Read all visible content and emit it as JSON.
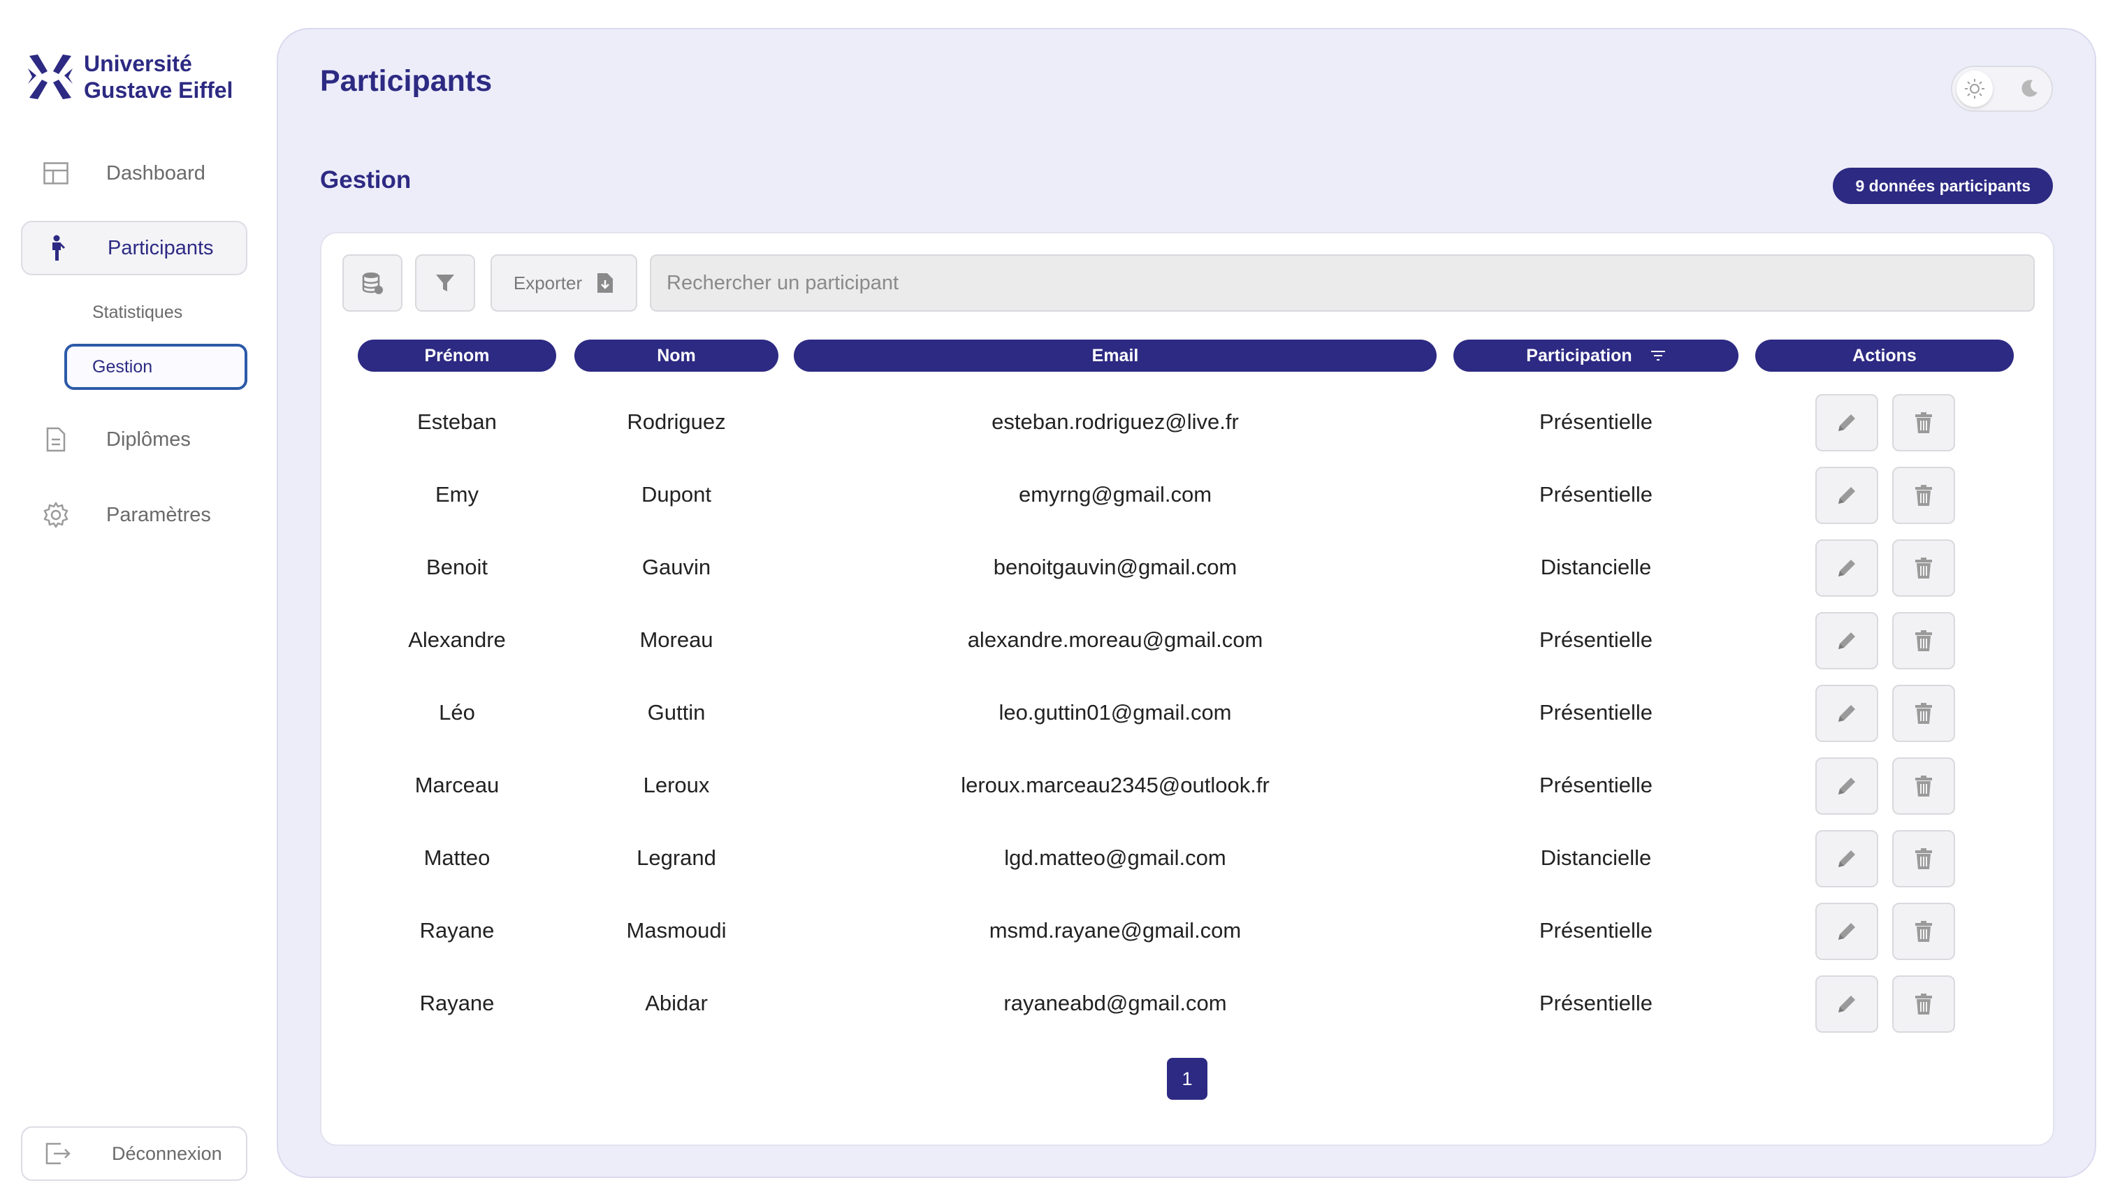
{
  "brand": {
    "line1": "Université",
    "line2": "Gustave Eiffel",
    "color": "#2d2a83"
  },
  "sidebar": {
    "items": [
      {
        "label": "Dashboard",
        "icon": "layout-icon"
      },
      {
        "label": "Participants",
        "icon": "person-icon",
        "active": true
      },
      {
        "label": "Diplômes",
        "icon": "document-icon"
      },
      {
        "label": "Paramètres",
        "icon": "gear-icon"
      }
    ],
    "subitems": [
      {
        "label": "Statistiques"
      },
      {
        "label": "Gestion",
        "active": true
      }
    ],
    "logout": "Déconnexion"
  },
  "header": {
    "title": "Participants"
  },
  "theme": {
    "light_icon": "sun-icon",
    "dark_icon": "moon-icon"
  },
  "section": {
    "title": "Gestion",
    "badge": "9 données participants"
  },
  "toolbar": {
    "db_icon": "database-icon",
    "filter_icon": "filter-icon",
    "export_label": "Exporter",
    "export_icon": "file-download-icon",
    "search_placeholder": "Rechercher un participant"
  },
  "table": {
    "columns": [
      "Prénom",
      "Nom",
      "Email",
      "Participation",
      "Actions"
    ],
    "sort_icon": "sort-icon",
    "rows": [
      {
        "prenom": "Esteban",
        "nom": "Rodriguez",
        "email": "esteban.rodriguez@live.fr",
        "participation": "Présentielle"
      },
      {
        "prenom": "Emy",
        "nom": "Dupont",
        "email": "emyrng@gmail.com",
        "participation": "Présentielle"
      },
      {
        "prenom": "Benoit",
        "nom": "Gauvin",
        "email": "benoitgauvin@gmail.com",
        "participation": "Distancielle"
      },
      {
        "prenom": "Alexandre",
        "nom": "Moreau",
        "email": "alexandre.moreau@gmail.com",
        "participation": "Présentielle"
      },
      {
        "prenom": "Léo",
        "nom": "Guttin",
        "email": "leo.guttin01@gmail.com",
        "participation": "Présentielle"
      },
      {
        "prenom": "Marceau",
        "nom": "Leroux",
        "email": "leroux.marceau2345@outlook.fr",
        "participation": "Présentielle"
      },
      {
        "prenom": "Matteo",
        "nom": "Legrand",
        "email": "lgd.matteo@gmail.com",
        "participation": "Distancielle"
      },
      {
        "prenom": "Rayane",
        "nom": "Masmoudi",
        "email": "msmd.rayane@gmail.com",
        "participation": "Présentielle"
      },
      {
        "prenom": "Rayane",
        "nom": "Abidar",
        "email": "rayaneabd@gmail.com",
        "participation": "Présentielle"
      }
    ],
    "edit_icon": "pencil-icon",
    "delete_icon": "trash-icon"
  },
  "pagination": {
    "current": "1"
  }
}
